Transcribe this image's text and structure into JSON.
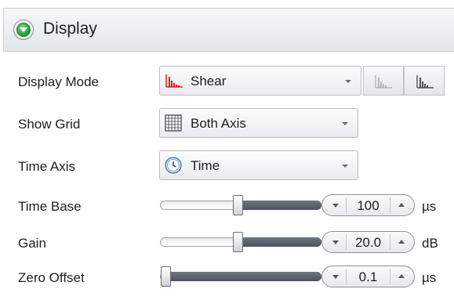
{
  "header": {
    "title": "Display",
    "collapse_icon": "green-chevron-down-icon"
  },
  "display_mode": {
    "label": "Display Mode",
    "value": "Shear",
    "icon": "shear-waveform-icon",
    "buttons": [
      "waveform-outline-icon",
      "waveform-filled-icon"
    ]
  },
  "show_grid": {
    "label": "Show Grid",
    "value": "Both Axis",
    "icon": "grid-icon"
  },
  "time_axis": {
    "label": "Time Axis",
    "value": "Time",
    "icon": "clock-icon"
  },
  "time_base": {
    "label": "Time Base",
    "value": "100",
    "unit": "µs",
    "slider_fraction": 0.48
  },
  "gain": {
    "label": "Gain",
    "value": "20.0",
    "unit": "dB",
    "slider_fraction": 0.48
  },
  "zero_offset": {
    "label": "Zero Offset",
    "value": "0.1",
    "unit": "µs",
    "slider_fraction": 0.0
  },
  "colors": {
    "accent_green": "#1e9a35",
    "shear_red": "#d81e1e"
  }
}
